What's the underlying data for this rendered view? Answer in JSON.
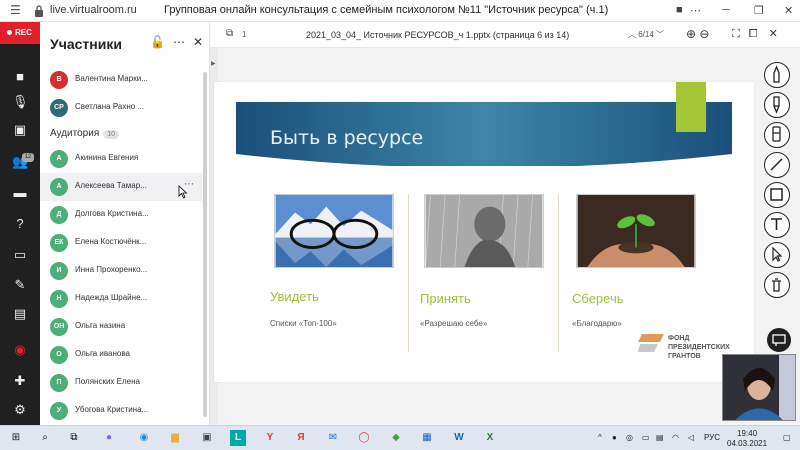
{
  "window": {
    "url": "live.virtualroom.ru",
    "title": "Групповая онлайн консультация с семейным психологом №11 \"Источник ресурса\" (ч.1)"
  },
  "leftnav": {
    "rec_label": "REC",
    "participants_badge": "12"
  },
  "panel": {
    "title": "Участники",
    "section_label": "Аудитория",
    "section_count": "10",
    "hosts": [
      {
        "initials": "В",
        "name": "Валентина Марки...",
        "color": "#d32f2f"
      },
      {
        "initials": "СР",
        "name": "Светлана Рахно ...",
        "color": "#2e6b78"
      }
    ],
    "audience": [
      {
        "initials": "А",
        "name": "Акинина Евгения",
        "color": "#4caf7a"
      },
      {
        "initials": "А",
        "name": "Алексеева Тамар...",
        "color": "#4caf7a"
      },
      {
        "initials": "Д",
        "name": "Долгова Кристина...",
        "color": "#4caf7a"
      },
      {
        "initials": "ЕК",
        "name": "Елена Костючёнк...",
        "color": "#4caf7a"
      },
      {
        "initials": "И",
        "name": "Инна Прохоренко...",
        "color": "#4caf7a"
      },
      {
        "initials": "Н",
        "name": "Надежда Шрайне...",
        "color": "#4caf7a"
      },
      {
        "initials": "ОН",
        "name": "Ольга назина",
        "color": "#4caf7a"
      },
      {
        "initials": "О",
        "name": "Ольга иванова",
        "color": "#4caf7a"
      },
      {
        "initials": "П",
        "name": "Полянских Елена",
        "color": "#4caf7a"
      },
      {
        "initials": "У",
        "name": "Убогова Кристина...",
        "color": "#4caf7a"
      }
    ]
  },
  "content": {
    "page_number": "1",
    "file_name": "2021_03_04_ Источник РЕСУРСОВ_ч 1.pptx (страница 6 из 14)",
    "pager": "6/14"
  },
  "slide": {
    "title": "Быть в ресурсе",
    "columns": [
      {
        "title": "Увидеть",
        "subtitle": "Списки «Топ-100»"
      },
      {
        "title": "Принять",
        "subtitle": "«Разрешаю себе»"
      },
      {
        "title": "Сберечь",
        "subtitle": "«Благодарю»"
      }
    ],
    "logo_text": [
      "ФОНД",
      "ПРЕЗИДЕНТСКИХ",
      "ГРАНТОВ"
    ]
  },
  "taskbar": {
    "time": "19:40",
    "date": "04.03.2021",
    "lang": "РУС"
  },
  "colors": {
    "rec": "#e0202a",
    "accent_green": "#a4c637",
    "nav_bg": "#202020"
  }
}
